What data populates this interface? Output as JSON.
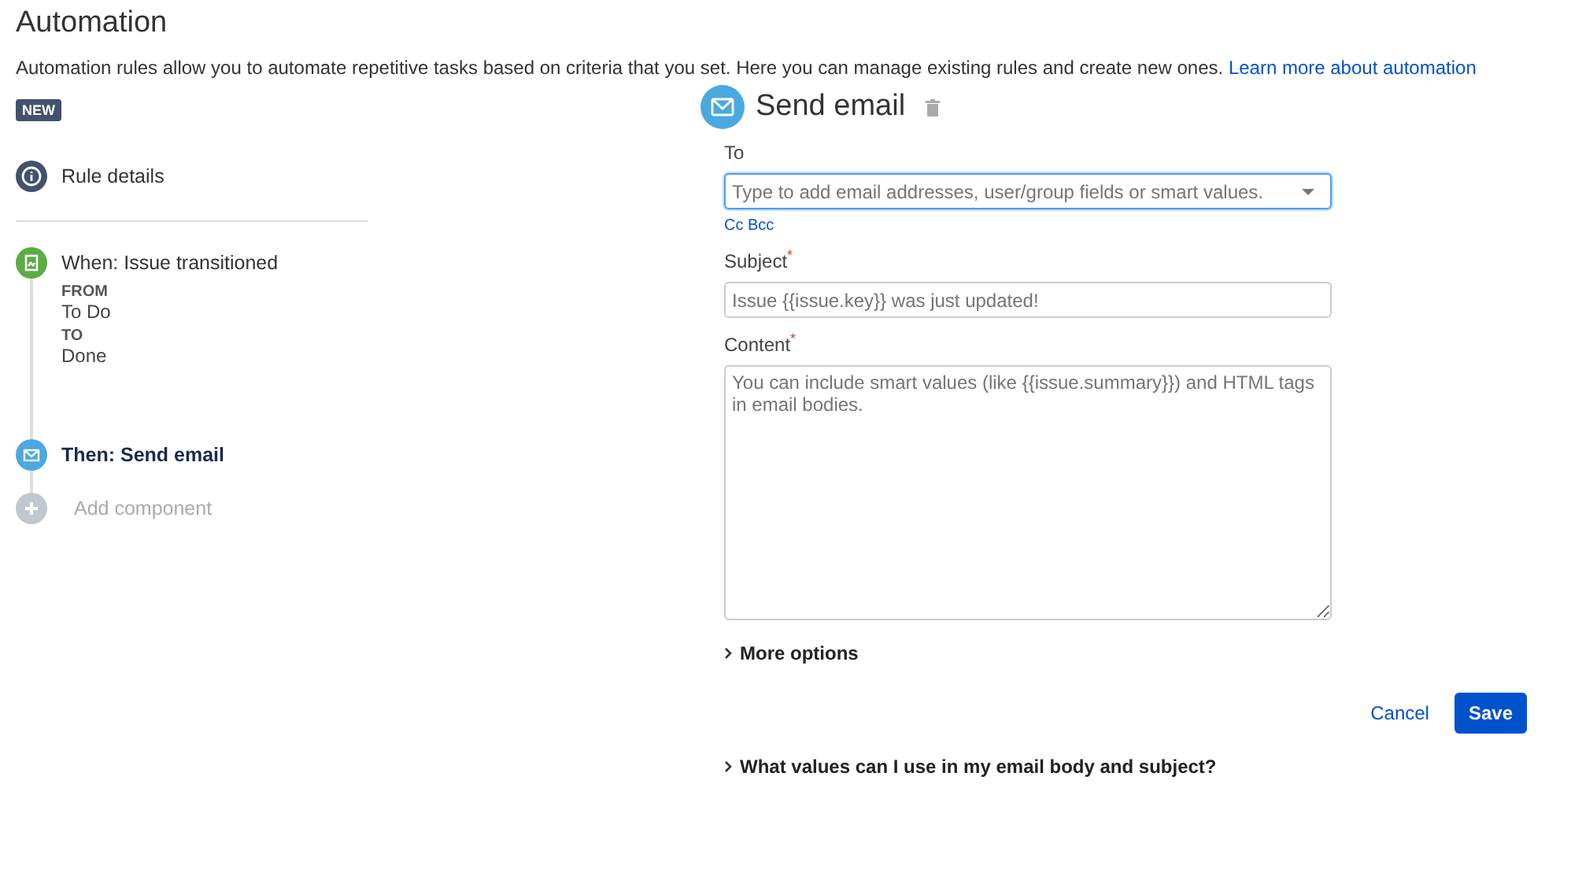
{
  "title": "Automation",
  "intro": {
    "text": "Automation rules allow you to automate repetitive tasks based on criteria that you set. Here you can manage existing rules and create new ones.",
    "link": "Learn more about automation"
  },
  "badge": "NEW",
  "steps": [
    {
      "kind": "details",
      "label": "Rule details",
      "selected": false
    },
    {
      "kind": "trigger",
      "label": "When: Issue transitioned",
      "selected": false,
      "details": [
        {
          "label": "FROM",
          "value": "To Do"
        },
        {
          "label": "TO",
          "value": "Done"
        }
      ]
    },
    {
      "kind": "action",
      "label": "Then: Send email",
      "selected": true
    },
    {
      "kind": "add",
      "label": "Add component",
      "selected": false
    }
  ],
  "editor": {
    "title": "Send email",
    "to": {
      "label": "To",
      "placeholder": "Type to add email addresses, user/group fields or smart values."
    },
    "cc_link": "Cc Bcc",
    "subject": {
      "label": "Subject$^{*}$",
      "placeholder": "Issue {{issue.key}} was just updated!"
    },
    "content": {
      "label": "Content$^{*}$",
      "placeholder": "You can include smart values (like {{issue.summary}}) and HTML tags in email bodies."
    },
    "more_options": "More options",
    "cancel": "Cancel",
    "save": "Save",
    "help": "What values can I use in my email body and subject?"
  }
}
